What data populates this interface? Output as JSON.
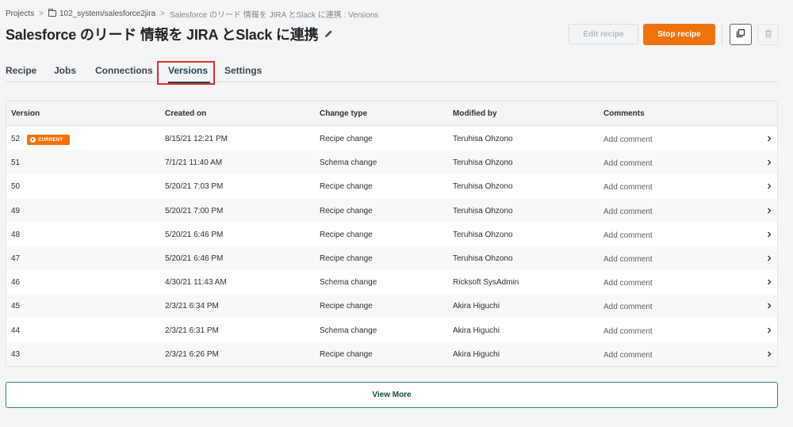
{
  "breadcrumb": {
    "projects": "Projects",
    "folder": "102_system/salesforce2jira",
    "current": "Salesforce のリード 情報を JIRA とSlack に連携 : Versions"
  },
  "title": "Salesforce のリード 情報を JIRA とSlack に連携",
  "buttons": {
    "edit": "Edit recipe",
    "stop": "Stop recipe"
  },
  "tabs": [
    "Recipe",
    "Jobs",
    "Connections",
    "Versions",
    "Settings"
  ],
  "active_tab": "Versions",
  "table": {
    "headers": [
      "Version",
      "Created on",
      "Change type",
      "Modified by",
      "Comments"
    ],
    "current_badge": "CURRENT",
    "rows": [
      {
        "version": "52",
        "created": "8/15/21 12:21 PM",
        "change": "Recipe change",
        "modified": "Teruhisa Ohzono",
        "comment": "Add comment"
      },
      {
        "version": "51",
        "created": "7/1/21 11:40 AM",
        "change": "Schema change",
        "modified": "Teruhisa Ohzono",
        "comment": "Add comment"
      },
      {
        "version": "50",
        "created": "5/20/21 7:03 PM",
        "change": "Recipe change",
        "modified": "Teruhisa Ohzono",
        "comment": "Add comment"
      },
      {
        "version": "49",
        "created": "5/20/21 7:00 PM",
        "change": "Recipe change",
        "modified": "Teruhisa Ohzono",
        "comment": "Add comment"
      },
      {
        "version": "48",
        "created": "5/20/21 6:46 PM",
        "change": "Recipe change",
        "modified": "Teruhisa Ohzono",
        "comment": "Add comment"
      },
      {
        "version": "47",
        "created": "5/20/21 6:46 PM",
        "change": "Recipe change",
        "modified": "Teruhisa Ohzono",
        "comment": "Add comment"
      },
      {
        "version": "46",
        "created": "4/30/21 11:43 AM",
        "change": "Schema change",
        "modified": "Ricksoft SysAdmin",
        "comment": "Add comment"
      },
      {
        "version": "45",
        "created": "2/3/21 6:34 PM",
        "change": "Recipe change",
        "modified": "Akira Higuchi",
        "comment": "Add comment"
      },
      {
        "version": "44",
        "created": "2/3/21 6:31 PM",
        "change": "Schema change",
        "modified": "Akira Higuchi",
        "comment": "Add comment"
      },
      {
        "version": "43",
        "created": "2/3/21 6:26 PM",
        "change": "Recipe change",
        "modified": "Akira Higuchi",
        "comment": "Add comment"
      }
    ]
  },
  "view_more": "View More",
  "colors": {
    "accent_orange": "#f0720d",
    "teal": "#17474f",
    "highlight_red": "#e0302a"
  }
}
